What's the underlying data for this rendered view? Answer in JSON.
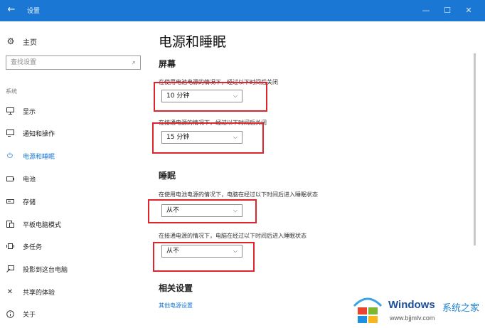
{
  "window": {
    "title": "设置",
    "back_glyph": "←",
    "min_glyph": "—",
    "max_glyph": "☐",
    "close_glyph": "✕",
    "accent_color": "#1a78d4"
  },
  "sidebar": {
    "home_label": "主页",
    "search_placeholder": "查找设置",
    "section_label": "系统",
    "items": [
      {
        "label": "显示",
        "icon": "monitor-icon"
      },
      {
        "label": "通知和操作",
        "icon": "notification-icon"
      },
      {
        "label": "电源和睡眠",
        "icon": "power-icon",
        "active": true
      },
      {
        "label": "电池",
        "icon": "battery-icon"
      },
      {
        "label": "存储",
        "icon": "storage-icon"
      },
      {
        "label": "平板电脑模式",
        "icon": "tablet-icon"
      },
      {
        "label": "多任务",
        "icon": "multitask-icon"
      },
      {
        "label": "投影到这台电脑",
        "icon": "project-icon"
      },
      {
        "label": "共享的体验",
        "icon": "shared-icon"
      },
      {
        "label": "关于",
        "icon": "info-icon"
      }
    ]
  },
  "main": {
    "title": "电源和睡眠",
    "screen": {
      "heading": "屏幕",
      "battery_desc": "在使用电池电源的情况下，经过以下时间后关闭",
      "battery_value": "10 分钟",
      "plugged_desc": "在接通电源的情况下，经过以下时间后关闭",
      "plugged_value": "15 分钟"
    },
    "sleep": {
      "heading": "睡眠",
      "battery_desc": "在使用电池电源的情况下，电脑在经过以下时间后进入睡眠状态",
      "battery_value": "从不",
      "plugged_desc": "在接通电源的情况下，电脑在经过以下时间后进入睡眠状态",
      "plugged_value": "从不"
    },
    "related": {
      "heading": "相关设置",
      "link": "其他电源设置"
    }
  },
  "watermark": {
    "brand": "Windows",
    "site_name": "系统之家",
    "url": "www.bjjmlv.com"
  },
  "highlight_color": "#e0242e"
}
